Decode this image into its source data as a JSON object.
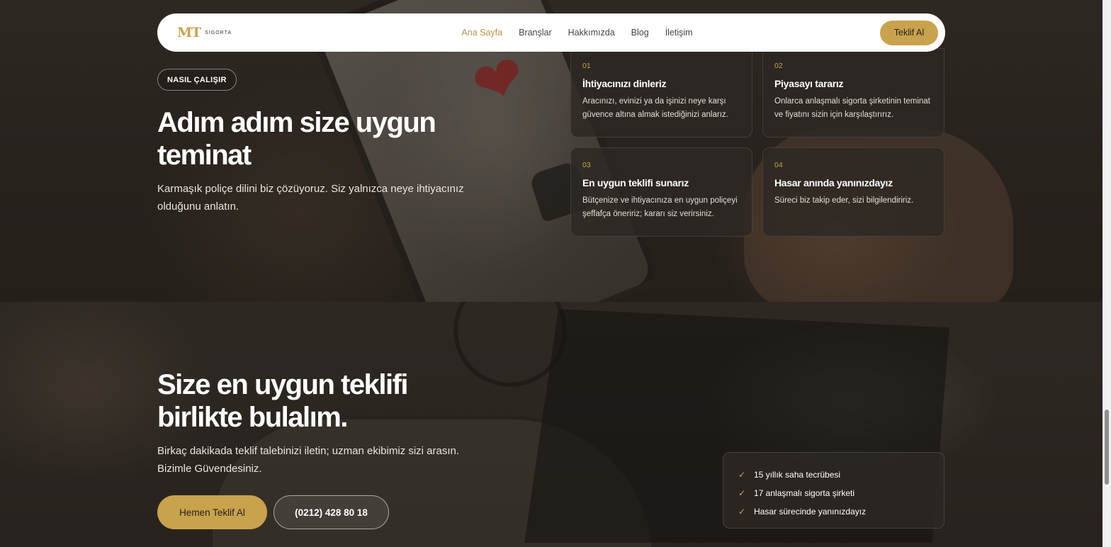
{
  "brand": {
    "logo_mark": "MT",
    "logo_text": "SİGORTA"
  },
  "nav": {
    "links": [
      "Ana Sayfa",
      "Branşlar",
      "Hakkımızda",
      "Blog",
      "İletişim"
    ],
    "active": "Ana Sayfa",
    "cta": "Teklif Al"
  },
  "how": {
    "badge": "NASIL ÇALIŞIR",
    "title": "Adım adım size uygun teminat",
    "lead": "Karmaşık poliçe dilini biz çözüyoruz. Siz yalnızca neye ihtiyacınız olduğunu anlatın.",
    "steps": [
      {
        "num": "01",
        "title": "İhtiyacınızı dinleriz",
        "text": "Aracınızı, evinizi ya da işinizi neye karşı güvence altına almak istediğinizi anlarız."
      },
      {
        "num": "02",
        "title": "Piyasayı tararız",
        "text": "Onlarca anlaşmalı sigorta şirketinin teminat ve fiyatını sizin için karşılaştırırız."
      },
      {
        "num": "03",
        "title": "En uygun teklifi sunarız",
        "text": "Bütçenize ve ihtiyacınıza en uygun poliçeyi şeffafça öneririz; kararı siz verirsiniz."
      },
      {
        "num": "04",
        "title": "Hasar anında yanınızdayız",
        "text": "Süreci biz takip eder, sizi bilgilendiririz."
      }
    ]
  },
  "cta_section": {
    "title": "Size en uygun teklifi birlikte bulalım.",
    "lead": "Birkaç dakikada teklif talebinizi iletin; uzman ekibimiz sizi arasın. Bizimle Güvendesiniz.",
    "primary_button": "Hemen Teklif Al",
    "phone_button": "(0212) 428 80 18",
    "features": [
      "15 yıllık saha tecrübesi",
      "17 anlaşmalı sigorta şirketi",
      "Hasar sürecinde yanınızdayız"
    ]
  },
  "colors": {
    "accent": "#c9a24d",
    "nav_bg": "#ffffff",
    "card_bg": "#2d2823"
  },
  "icons": {
    "check": "check-icon"
  }
}
